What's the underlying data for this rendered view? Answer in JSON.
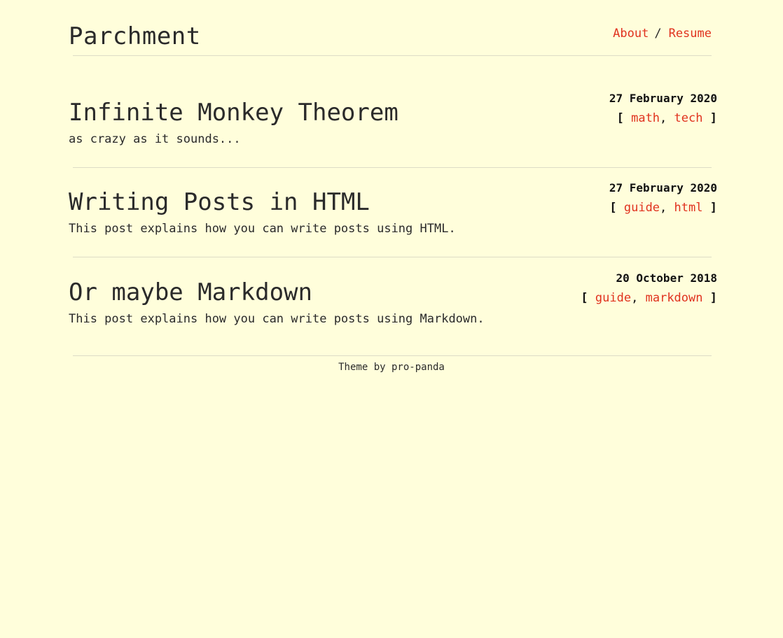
{
  "header": {
    "site_title": "Parchment",
    "nav": [
      {
        "label": "About"
      },
      {
        "label": "Resume"
      }
    ],
    "nav_separator": "/"
  },
  "posts": [
    {
      "title": "Infinite Monkey Theorem",
      "excerpt": "as crazy as it sounds...",
      "date": "27 February 2020",
      "tags": [
        "math",
        "tech"
      ]
    },
    {
      "title": "Writing Posts in HTML",
      "excerpt": "This post explains how you can write posts using HTML.",
      "date": "27 February 2020",
      "tags": [
        "guide",
        "html"
      ]
    },
    {
      "title": "Or maybe Markdown",
      "excerpt": "This post explains how you can write posts using Markdown.",
      "date": "20 October 2018",
      "tags": [
        "guide",
        "markdown"
      ]
    }
  ],
  "tag_brackets": {
    "open": "[",
    "close": "]",
    "comma": ","
  },
  "footer": {
    "prefix": "Theme by",
    "author": "pro-panda"
  },
  "colors": {
    "background": "#fffedb",
    "text": "#2a2a2a",
    "link": "#e0321e",
    "rule": "#dddcc6"
  }
}
